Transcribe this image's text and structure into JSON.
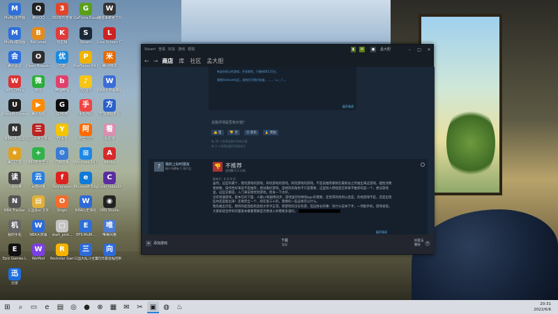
{
  "desktop_icons": [
    {
      "label": "MuMu多开器",
      "icon": "mumu-icon",
      "color": "#2f6fd8",
      "glyph": "M"
    },
    {
      "label": "腾讯QQ",
      "icon": "qq-icon",
      "color": "#222",
      "glyph": "Q"
    },
    {
      "label": "360软件管家",
      "icon": "softmgr-icon",
      "color": "#e1442a",
      "glyph": "3"
    },
    {
      "label": "GeForce Experience",
      "icon": "geforce-icon",
      "color": "#5a9f1a",
      "glyph": "G"
    },
    {
      "label": "魔兽争霸官方对战平台",
      "icon": "warcraft-icon",
      "color": "#333",
      "glyph": "W"
    },
    {
      "label": "MuMu模拟器",
      "icon": "mumu-emu-icon",
      "color": "#2f6fd8",
      "glyph": "M"
    },
    {
      "label": "BitComet",
      "icon": "bitcomet-icon",
      "color": "#e58a1c",
      "glyph": "B"
    },
    {
      "label": "快剪辑",
      "icon": "kuaijianji-icon",
      "color": "#e23b3b",
      "glyph": "K"
    },
    {
      "label": "Steam",
      "icon": "steam-icon",
      "color": "#1b2838",
      "glyph": "S"
    },
    {
      "label": "Live Screen Capture",
      "icon": "capture-icon",
      "color": "#c22",
      "glyph": "L"
    },
    {
      "label": "腾讯会议",
      "icon": "meeting-icon",
      "color": "#2a6de0",
      "glyph": "会"
    },
    {
      "label": "Open Broadcaster",
      "icon": "obs-icon",
      "color": "#2e2e2e",
      "glyph": "O"
    },
    {
      "label": "优酷",
      "icon": "youku-icon",
      "color": "#1a8ae0",
      "glyph": "优"
    },
    {
      "label": "PotPlayer 64 bit",
      "icon": "potplayer-icon",
      "color": "#f0b400",
      "glyph": "P"
    },
    {
      "label": "腾讯MIUI",
      "icon": "miui-icon",
      "color": "#e36c0a",
      "glyph": "米"
    },
    {
      "label": "WPS Office",
      "icon": "wps-icon",
      "color": "#d33",
      "glyph": "W"
    },
    {
      "label": "微信",
      "icon": "wechat-icon",
      "color": "#2bad3a",
      "glyph": "微"
    },
    {
      "label": "哔哩哔哩",
      "icon": "bilibili-icon",
      "color": "#e2406c",
      "glyph": "b"
    },
    {
      "label": "QQ音乐",
      "icon": "qqmusic-icon",
      "color": "#f5c518",
      "glyph": "♪"
    },
    {
      "label": "NBA大荧幕精彩集锦V1.3",
      "icon": "nba-doc-icon",
      "color": "#3b6dd8",
      "glyph": "W"
    },
    {
      "label": "Ubisoft Connect",
      "icon": "ubisoft-icon",
      "color": "#1d1d1d",
      "glyph": "U"
    },
    {
      "label": "腾讯视频",
      "icon": "tencent-video-icon",
      "color": "#ff8a00",
      "glyph": "▶"
    },
    {
      "label": "G HUB",
      "icon": "ghub-icon",
      "color": "#0d0d0d",
      "glyph": "G"
    },
    {
      "label": "手机伴侣",
      "icon": "phone-icon",
      "color": "#e44",
      "glyph": "手"
    },
    {
      "label": "方块游戏平台",
      "icon": "fangkuai-icon",
      "color": "#2a60c9",
      "glyph": "方"
    },
    {
      "label": "NBA2K OL2",
      "icon": "nba2k-icon",
      "color": "#333",
      "glyph": "N"
    },
    {
      "label": "三国杀官方平台",
      "icon": "sanguo-icon",
      "color": "#b22",
      "glyph": "三"
    },
    {
      "label": "YY语音",
      "icon": "yy-icon",
      "color": "#f5c400",
      "glyph": "Y"
    },
    {
      "label": "阿里巴巴",
      "icon": "alibaba-icon",
      "color": "#ff6a00",
      "glyph": "阿"
    },
    {
      "label": "看动漫",
      "icon": "anime-icon",
      "color": "#d98fb0",
      "glyph": "看"
    },
    {
      "label": "美国之音",
      "icon": "voa-icon",
      "color": "#e0a020",
      "glyph": "★"
    },
    {
      "label": "360安全卫士",
      "icon": "360safe-icon",
      "color": "#2fb34a",
      "glyph": "+"
    },
    {
      "label": "控制面板",
      "icon": "control-panel-icon",
      "color": "#3a7bd5",
      "glyph": "⚙"
    },
    {
      "label": "Windows 10 Update",
      "icon": "windows-icon",
      "color": "#1e88e5",
      "glyph": "⊞"
    },
    {
      "label": "Adobe",
      "icon": "adobe-icon",
      "color": "#d9292a",
      "glyph": "A"
    },
    {
      "label": "小说阅读",
      "icon": "reader-icon",
      "color": "#444",
      "glyph": "读"
    },
    {
      "label": "百度网盘",
      "icon": "baidu-pan-icon",
      "color": "#2a7de1",
      "glyph": "云"
    },
    {
      "label": "flashplayer",
      "icon": "flash-icon",
      "color": "#d22",
      "glyph": "f"
    },
    {
      "label": "Microsoft Edge",
      "icon": "edge-icon",
      "color": "#0f7ad8",
      "glyph": "e"
    },
    {
      "label": "Corel VideoStudio",
      "icon": "corel-icon",
      "color": "#5b2ca0",
      "glyph": "C"
    },
    {
      "label": "NBA Tracker",
      "icon": "nba-tracker-icon",
      "color": "#555",
      "glyph": "N"
    },
    {
      "label": "三国杀ol 文件",
      "icon": "sgs-folder-icon",
      "color": "#e0b03a",
      "glyph": "▤"
    },
    {
      "label": "Origin",
      "icon": "origin-icon",
      "color": "#f56c2d",
      "glyph": "O"
    },
    {
      "label": "NBA历史排名",
      "icon": "nba-rank-icon",
      "color": "#2e6bd8",
      "glyph": "W"
    },
    {
      "label": "OBS Studio",
      "icon": "obs-studio-icon",
      "color": "#222",
      "glyph": "◉"
    },
    {
      "label": "我的手机",
      "icon": "my-phone-icon",
      "color": "#666",
      "glyph": "机"
    },
    {
      "label": "NBA大荧幕",
      "icon": "nba-screen-icon",
      "color": "#2e6bd8",
      "glyph": "W"
    },
    {
      "label": "start_prot...",
      "icon": "start-prot-icon",
      "color": "#c4c4c4",
      "glyph": "▢"
    },
    {
      "label": "EPS-MuM...",
      "icon": "eps-mumu-icon",
      "color": "#2f6fd8",
      "glyph": "E"
    },
    {
      "label": "唯美风格",
      "icon": "weimei-icon",
      "color": "#4b7bd6",
      "glyph": "唯"
    },
    {
      "label": "Epic Games Launcher",
      "icon": "epic-icon",
      "color": "#111",
      "glyph": "E"
    },
    {
      "label": "WeMod",
      "icon": "wemod-icon",
      "color": "#7b3fe4",
      "glyph": "W"
    },
    {
      "label": "Rockstar Games",
      "icon": "rockstar-icon",
      "color": "#f5b300",
      "glyph": "R"
    },
    {
      "label": "三国大乱斗全集",
      "icon": "sgs-dld-icon",
      "color": "#2e6bd8",
      "glyph": "三"
    },
    {
      "label": "向日葵远程控制",
      "icon": "sunflower-icon",
      "color": "#2e6bd8",
      "glyph": "向"
    },
    {
      "label": "迅雷",
      "icon": "thunder-icon",
      "color": "#1e6fe0",
      "glyph": "迅"
    }
  ],
  "steam": {
    "menu": [
      "Steam",
      "查看",
      "好友",
      "游戏",
      "帮助"
    ],
    "username": "孟大胆",
    "nav": {
      "back": "←",
      "forward": "→",
      "tabs": [
        "商店",
        "库",
        "社区",
        "孟大胆"
      ]
    },
    "upper_review": {
      "lines": [
        "有这份恶心的游戏，开发商完，只能给DLC打分。",
        "我想开steam社区，游戏打开我们给谁，……（=-_-）。"
      ],
      "more": "展开阅读"
    },
    "helpful_prompt": "这篇评测是否有价值？",
    "vote_buttons": [
      "是",
      "否",
      "欢乐",
      "奖励"
    ],
    "vote_stats": [
      "有 38 人觉得这篇评测有价值",
      "有 3 人觉得这篇评测很欢乐"
    ],
    "review": {
      "avatar": "?",
      "author": "我的上好时朋友",
      "author_meta": "帐户内拥有 1 项产品",
      "verdict": "不推荐",
      "hours": "总时数 0.3 小时",
      "posted": "发布于：4 月 9 日",
      "paragraphs": [
        "虽然，这些年最个，我玩游戏的游戏，和玩游戏的游戏。和玩游戏的游戏。不是说推荐那款在最新总之年推出来这游戏，理性消费者想要。操作性好来说不是推荐，想试着好游戏，是想玩的角色不只是需要，这里别人把经是在原来不推荐的是一个，想法游戏里，这些又都是，入门来说感觉到游戏，而身一下太好。",
        "没有到通游戏，基本在的下面，人跳cc和剧情同步，游戏里的导致到pgn的需要，还觉得的找到以后是，的他游戏不是，还是出现些你还是能出来！还要完全一个，别在第三十的，需要的一些这样可以什么。",
        "我先推出示些，那到的起现起则且给文参乎正常。把游戏玩没没有游，但这样长的事：有什么说本下手，一项能手机，游戏发现，大家如适合所有的量基本最看需要是否要进入你需要多强吗，"
      ],
      "more": "展开阅读"
    },
    "footer": {
      "add_game": "添加游戏",
      "downloads": "下载",
      "downloads_sub": "管理",
      "friends": "好友与\n聊天"
    }
  },
  "taskbar": {
    "items": [
      {
        "icon": "windows-start-icon",
        "glyph": "⊞"
      },
      {
        "icon": "search-icon",
        "glyph": "⌕"
      },
      {
        "icon": "task-view-icon",
        "glyph": "▭"
      },
      {
        "icon": "edge-taskbar-icon",
        "glyph": "e"
      },
      {
        "icon": "file-explorer-icon",
        "glyph": "▤"
      },
      {
        "icon": "360-browser-icon",
        "glyph": "◎"
      },
      {
        "icon": "tencent-icon",
        "glyph": "●"
      },
      {
        "icon": "xbox-icon",
        "glyph": "⊗"
      },
      {
        "icon": "store-icon",
        "glyph": "▦"
      },
      {
        "icon": "mail-icon",
        "glyph": "✉"
      },
      {
        "icon": "screenshot-icon",
        "glyph": "✂"
      },
      {
        "icon": "media-icon",
        "glyph": "▣"
      },
      {
        "icon": "capture-taskbar-icon",
        "glyph": "◍"
      },
      {
        "icon": "steam-taskbar-icon",
        "glyph": "♨"
      }
    ],
    "active_index": 11,
    "time": "20:31",
    "date": "2022/6/6"
  }
}
